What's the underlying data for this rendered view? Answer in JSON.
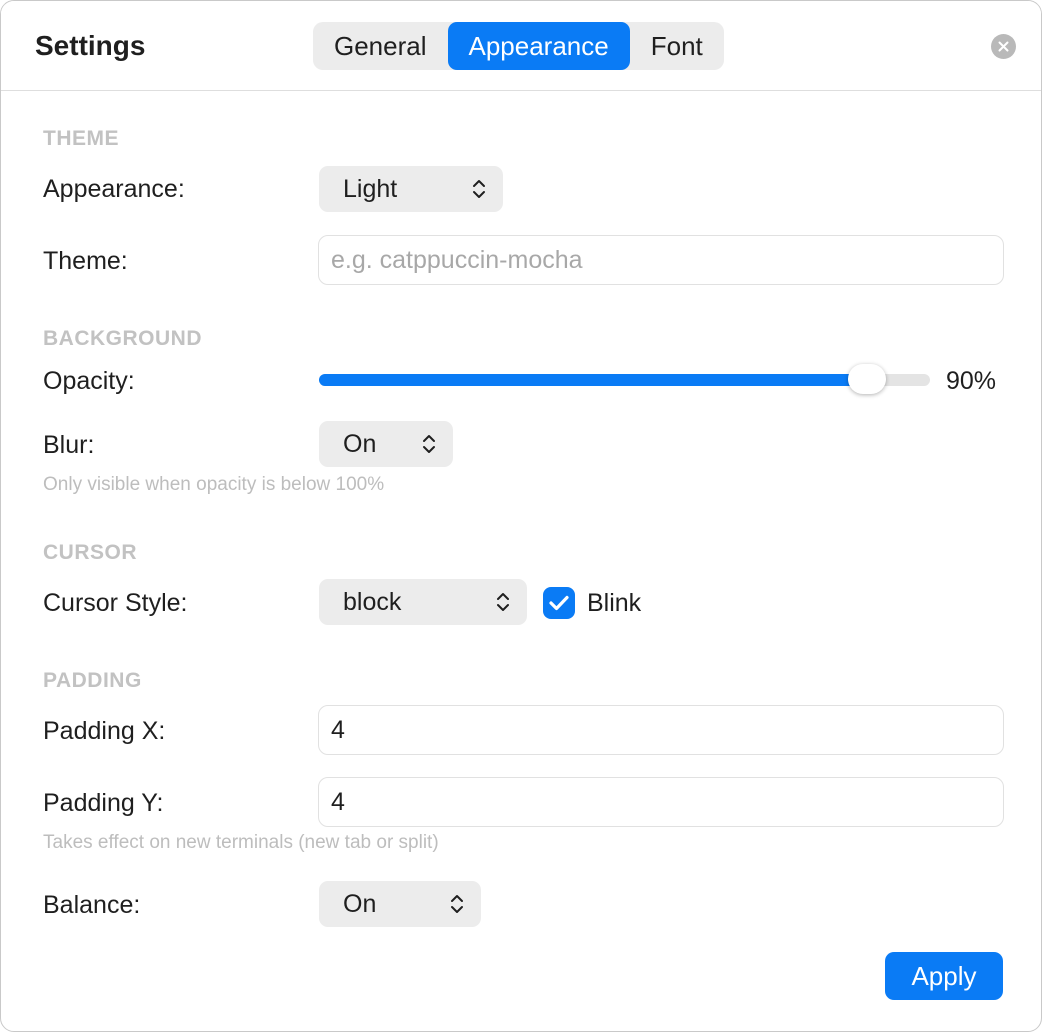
{
  "window": {
    "title": "Settings",
    "tabs": [
      {
        "label": "General",
        "active": false
      },
      {
        "label": "Appearance",
        "active": true
      },
      {
        "label": "Font",
        "active": false
      }
    ]
  },
  "colors": {
    "accent": "#0a7bf5",
    "section_label": "#c2c2c2",
    "hint": "#bdbdbd",
    "control_bg": "#ececec"
  },
  "sections": {
    "theme": {
      "label": "THEME",
      "appearance_label": "Appearance:",
      "appearance_value": "Light",
      "theme_label": "Theme:",
      "theme_value": "",
      "theme_placeholder": "e.g. catppuccin-mocha"
    },
    "background": {
      "label": "BACKGROUND",
      "opacity_label": "Opacity:",
      "opacity_percent": 90,
      "opacity_display": "90%",
      "blur_label": "Blur:",
      "blur_value": "On",
      "blur_hint": "Only visible when opacity is below 100%"
    },
    "cursor": {
      "label": "CURSOR",
      "style_label": "Cursor Style:",
      "style_value": "block",
      "blink_label": "Blink",
      "blink_checked": true
    },
    "padding": {
      "label": "PADDING",
      "x_label": "Padding X:",
      "x_value": "4",
      "y_label": "Padding Y:",
      "y_value": "4",
      "hint": "Takes effect on new terminals (new tab or split)",
      "balance_label": "Balance:",
      "balance_value": "On"
    }
  },
  "actions": {
    "apply_label": "Apply"
  },
  "icons": {
    "close": "close-icon",
    "popup_chevron": "up-down-chevron-icon",
    "checkmark": "checkmark-icon"
  }
}
